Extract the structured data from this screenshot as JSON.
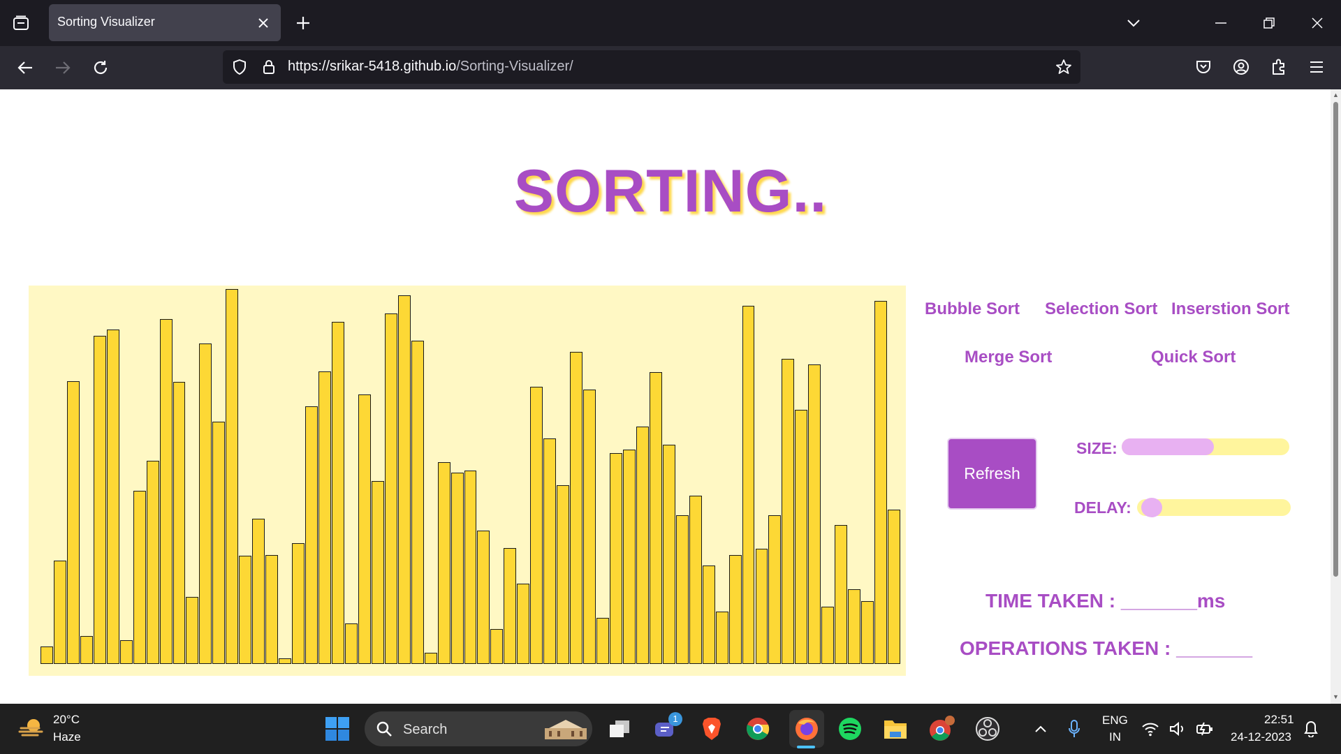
{
  "browser": {
    "tab_title": "Sorting Visualizer",
    "url_host": "https://srikar-5418.github.io",
    "url_path": "/Sorting-Visualizer/"
  },
  "page": {
    "heading": "SORTING..",
    "algorithms": [
      "Bubble Sort",
      "Selection Sort",
      "Inserstion Sort",
      "Merge Sort",
      "Quick Sort"
    ],
    "refresh_label": "Refresh",
    "size_label": "SIZE:",
    "delay_label": "DELAY:",
    "size_level": 0.55,
    "delay_level": 0.03,
    "time_taken_label": "TIME TAKEN : _______ms",
    "operations_label": "OPERATIONS TAKEN : _______",
    "array_values": [
      4.6,
      27.3,
      74.8,
      7.4,
      86.7,
      88.3,
      6.2,
      45.7,
      53.7,
      91.2,
      74.5,
      17.8,
      84.7,
      64.1,
      99,
      28.6,
      38.4,
      28.8,
      1.4,
      32,
      68.1,
      77.4,
      90.4,
      10.7,
      71.2,
      48.4,
      92.6,
      97.5,
      85.5,
      3,
      53.3,
      50.6,
      51.1,
      35.3,
      9.2,
      30.7,
      21.2,
      73.2,
      59.6,
      47.2,
      82.4,
      72.6,
      12.2,
      55.7,
      56.7,
      62.8,
      77.1,
      58,
      39.3,
      44.4,
      26,
      13.8,
      28.7,
      94.6,
      30.5,
      39.4,
      80.6,
      67.1,
      79.2,
      15.1,
      36.8,
      19.8,
      16.6,
      95.9,
      40.7
    ]
  },
  "taskbar": {
    "weather_temp": "20°C",
    "weather_desc": "Haze",
    "search_placeholder": "Search",
    "lang_top": "ENG",
    "lang_bottom": "IN",
    "time": "22:51",
    "date": "24-12-2023",
    "teams_badge": "1"
  }
}
